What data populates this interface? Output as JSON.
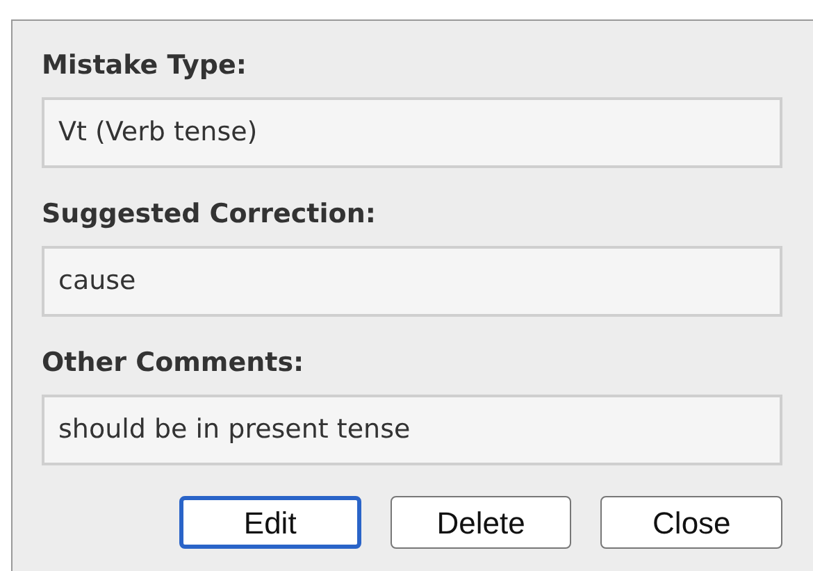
{
  "fields": [
    {
      "label": "Mistake Type:",
      "value": "Vt (Verb tense)"
    },
    {
      "label": "Suggested Correction:",
      "value": "cause"
    },
    {
      "label": "Other Comments:",
      "value": "should be in present tense"
    }
  ],
  "buttons": [
    {
      "label": "Edit",
      "focused": true
    },
    {
      "label": "Delete",
      "focused": false
    },
    {
      "label": "Close",
      "focused": false
    }
  ]
}
